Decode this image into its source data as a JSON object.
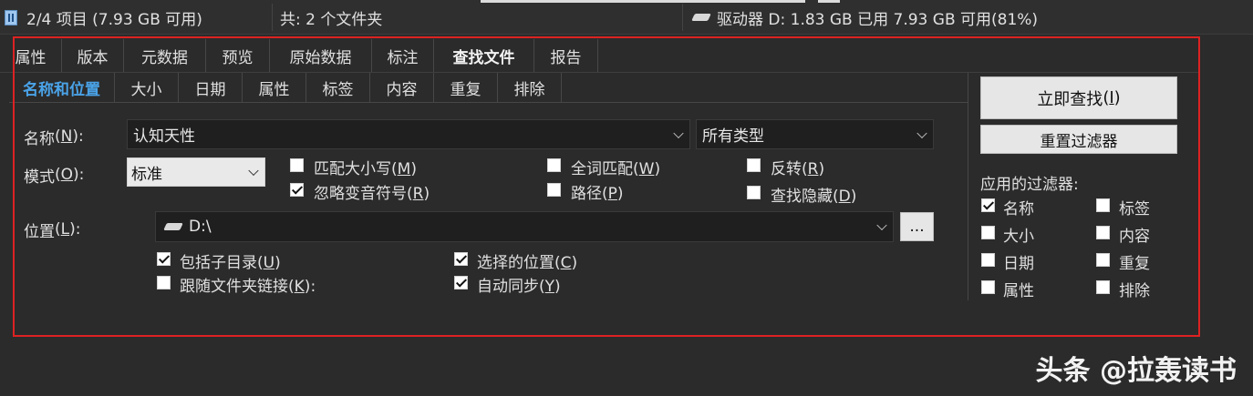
{
  "statusbar": {
    "items_label": "2/4 项目 (7.93 GB 可用)",
    "folders_label": "共: 2 个文件夹",
    "drive_label": "驱动器 D:  1.83 GB 已用   7.93 GB 可用(81%)"
  },
  "tabs_top": [
    "属性",
    "版本",
    "元数据",
    "预览",
    "原始数据",
    "标注",
    "查找文件",
    "报告"
  ],
  "tabs_sub": [
    "名称和位置",
    "大小",
    "日期",
    "属性",
    "标签",
    "内容",
    "重复",
    "排除"
  ],
  "form": {
    "name_label": "名称",
    "name_accel": "N",
    "name_value": "认知天性",
    "type_value": "所有类型",
    "mode_label": "模式",
    "mode_accel": "O",
    "mode_value": "标准",
    "location_label": "位置",
    "location_accel": "L",
    "location_value": "D:\\",
    "browse_label": "..."
  },
  "options": {
    "match_case": {
      "text": "匹配大小写",
      "accel": "M",
      "checked": false
    },
    "whole_words": {
      "text": "全词匹配",
      "accel": "W",
      "checked": false
    },
    "invert": {
      "text": "反转",
      "accel": "R",
      "checked": false
    },
    "ignore_diacritics": {
      "text": "忽略变音符号",
      "accel": "R",
      "checked": true
    },
    "path": {
      "text": "路径",
      "accel": "P",
      "checked": false
    },
    "find_hidden": {
      "text": "查找隐藏",
      "accel": "D",
      "checked": false
    },
    "include_subdirs": {
      "text": "包括子目录",
      "accel": "U",
      "checked": true
    },
    "follow_links": {
      "text": "跟随文件夹链接",
      "accel": "K",
      "suffix": ":",
      "checked": false
    },
    "selected_locations": {
      "text": "选择的位置",
      "accel": "C",
      "checked": true
    },
    "auto_sync": {
      "text": "自动同步",
      "accel": "Y",
      "checked": true
    }
  },
  "actions": {
    "find_now": "立即查找",
    "find_now_accel": "I",
    "reset_filters": "重置过滤器"
  },
  "filters": {
    "title": "应用的过滤器:",
    "items": [
      {
        "label": "名称",
        "checked": true
      },
      {
        "label": "标签",
        "checked": false
      },
      {
        "label": "大小",
        "checked": false
      },
      {
        "label": "内容",
        "checked": false
      },
      {
        "label": "日期",
        "checked": false
      },
      {
        "label": "重复",
        "checked": false
      },
      {
        "label": "属性",
        "checked": false
      },
      {
        "label": "排除",
        "checked": false
      }
    ]
  },
  "watermark": "头条 @拉轰读书"
}
